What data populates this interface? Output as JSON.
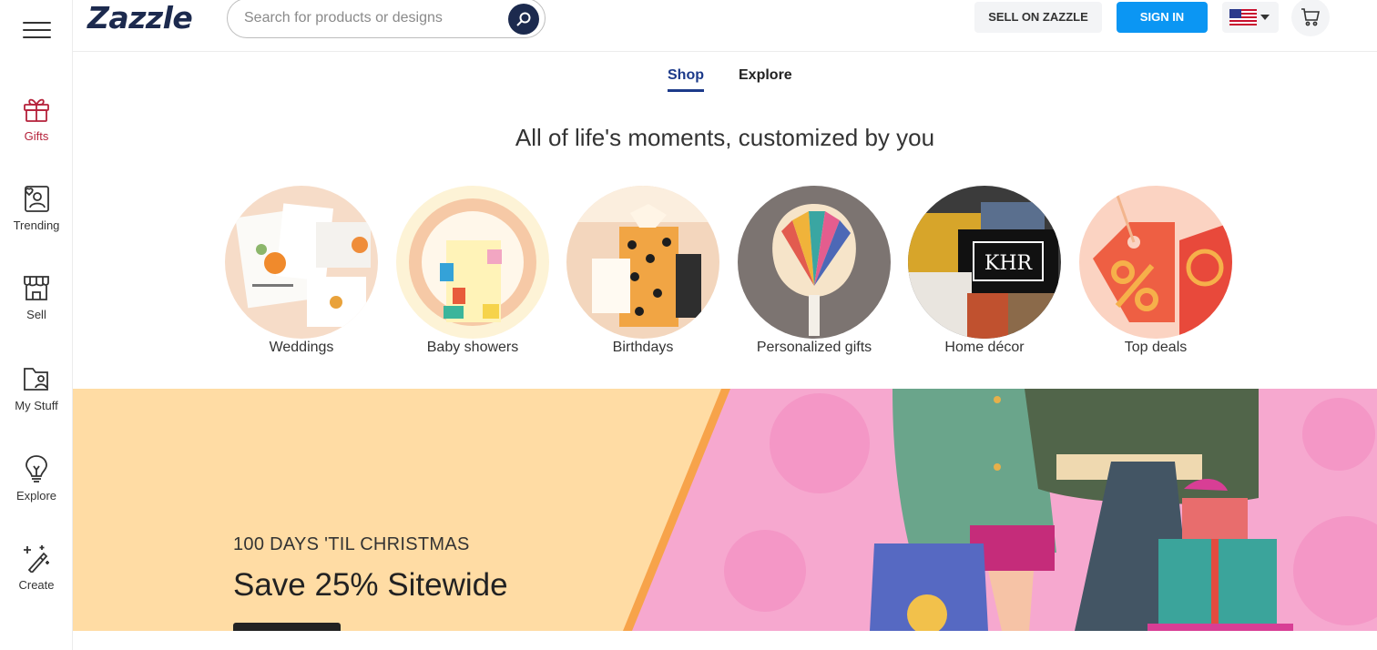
{
  "header": {
    "logo": "Zazzle",
    "search_placeholder": "Search for products or designs",
    "sell_label": "SELL ON ZAZZLE",
    "signin_label": "SIGN IN"
  },
  "sidebar": {
    "items": [
      {
        "label": "Gifts",
        "icon": "gift-icon"
      },
      {
        "label": "Trending",
        "icon": "trending-icon"
      },
      {
        "label": "Sell",
        "icon": "store-icon"
      },
      {
        "label": "My Stuff",
        "icon": "folder-icon"
      },
      {
        "label": "Explore",
        "icon": "lightbulb-icon"
      },
      {
        "label": "Create",
        "icon": "magic-wand-icon"
      }
    ]
  },
  "tabs": [
    {
      "label": "Shop",
      "active": true
    },
    {
      "label": "Explore",
      "active": false
    }
  ],
  "hero": {
    "title": "All of life's moments, customized by you"
  },
  "categories": [
    {
      "label": "Weddings"
    },
    {
      "label": "Baby showers"
    },
    {
      "label": "Birthdays"
    },
    {
      "label": "Personalized gifts"
    },
    {
      "label": "Home décor"
    },
    {
      "label": "Top deals"
    }
  ],
  "banner": {
    "kicker": "100 DAYS 'TIL CHRISTMAS",
    "headline": "Save 25% Sitewide"
  },
  "colors": {
    "brand_navy": "#1c2a4e",
    "signin_blue": "#0b96f3",
    "gifts_accent": "#b5213a",
    "tab_active": "#1c3a8a",
    "banner_peach": "#ffdca4",
    "banner_pink": "#f79ac6"
  }
}
